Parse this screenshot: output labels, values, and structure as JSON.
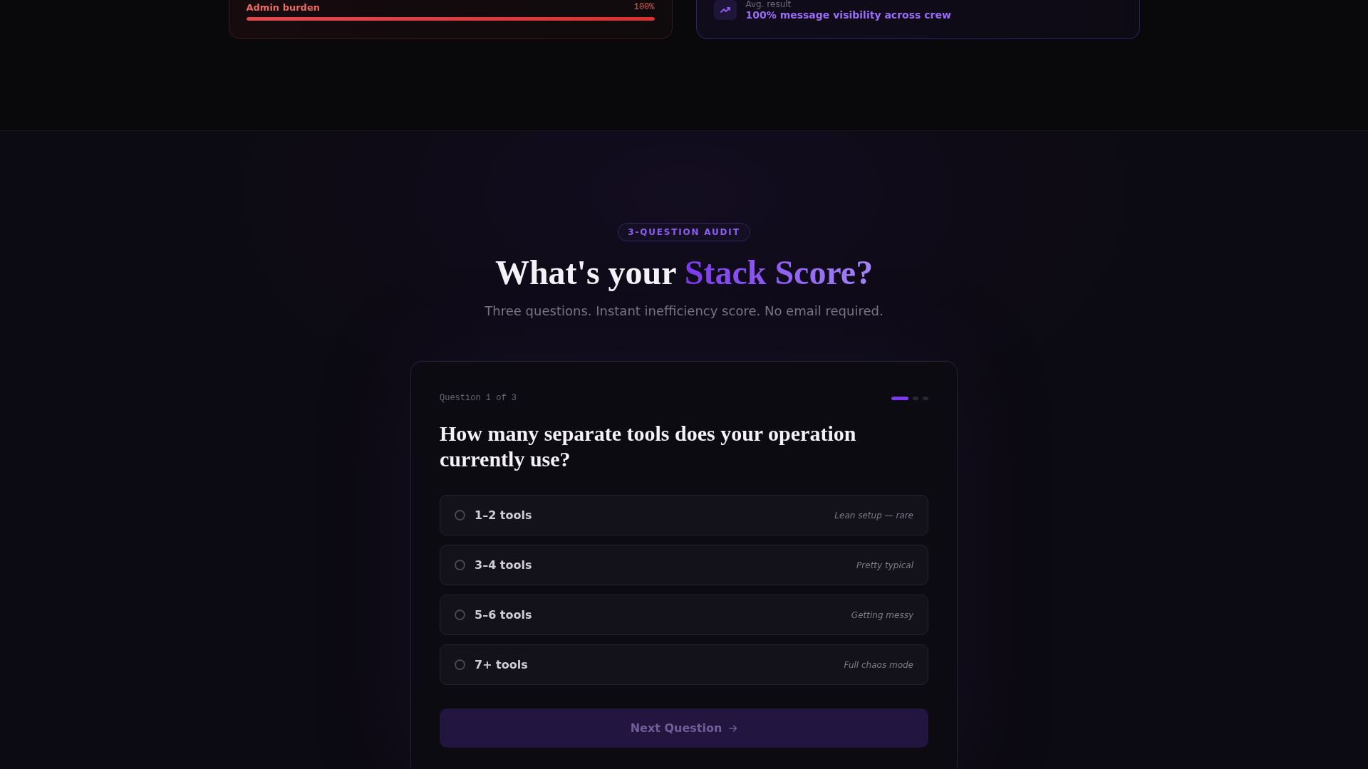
{
  "stat_cards": [
    {
      "kind": "meter",
      "label": "Admin burden",
      "reading": "100%",
      "level": 1.0
    },
    {
      "kind": "result",
      "label": "Avg. result",
      "value": "100% message visibility across crew"
    }
  ],
  "audit": {
    "badge": "3-QUESTION AUDIT",
    "title": "What's your",
    "title_highlight": "Stack Score?",
    "subtitle": "Three questions. Instant inefficiency score. No email required.",
    "quiz": {
      "progress_label": "Question 1 of 3",
      "steps": [
        {
          "selected": true
        },
        {
          "selected": false
        },
        {
          "selected": false
        }
      ],
      "question": "How many separate tools does your operation currently use?",
      "options": [
        {
          "label": "1–2 tools",
          "hint": "Lean setup — rare",
          "selected": false
        },
        {
          "label": "3–4 tools",
          "hint": "Pretty typical",
          "selected": false
        },
        {
          "label": "5–6 tools",
          "hint": "Getting messy",
          "selected": false
        },
        {
          "label": "7+ tools",
          "hint": "Full chaos mode",
          "selected": false
        }
      ],
      "next_button": {
        "label": "Next Question",
        "disabled": true
      }
    }
  }
}
